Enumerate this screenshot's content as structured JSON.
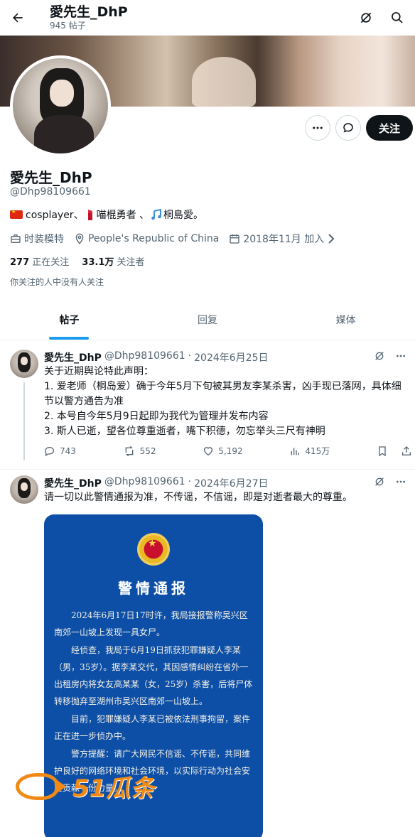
{
  "header": {
    "back_icon": "arrow-left-icon",
    "name": "愛先生_DhP",
    "post_count": "945 帖子",
    "grok_icon": "grok-icon",
    "search_icon": "search-icon"
  },
  "profile": {
    "name": "愛先生_DhP",
    "handle": "@Dhp98109661",
    "bio_part1": "cosplayer、",
    "bio_part2": "喵棍勇者 、",
    "bio_part3": "桐島愛。",
    "profession": "时装模特",
    "location": "People's Republic of China",
    "joined": "2018年11月 加入",
    "following_count": "277",
    "following_label": "正在关注",
    "followers_count": "33.1万",
    "followers_label": "关注者",
    "followers_note": "你关注的人中没有人关注",
    "follow_button": "关注"
  },
  "tabs": [
    {
      "label": "帖子",
      "active": true
    },
    {
      "label": "回复",
      "active": false
    },
    {
      "label": "媒体",
      "active": false
    }
  ],
  "posts": [
    {
      "author": "愛先生_DhP",
      "handle": "@Dhp98109661",
      "date": "2024年6月25日",
      "lines": [
        "关于近期舆论特此声明：",
        "1. 爱老师（桐岛爱）确于今年5月下旬被其男友李某杀害，凶手现已落网，具体细节以警方通告为准",
        "2. 本号自今年5月9日起即为我代为管理并发布内容",
        "3. 斯人已逝，望各位尊重逝者，嘴下积德，勿忘举头三尺有神明"
      ],
      "replies": "743",
      "reposts": "552",
      "likes": "5,192",
      "views": "415万"
    },
    {
      "author": "愛先生_DhP",
      "handle": "@Dhp98109661",
      "date": "2024年6月27日",
      "text": "请一切以此警情通报为准，不传谣，不信谣，即是对逝者最大的尊重。"
    }
  ],
  "notice": {
    "title": "警情通报",
    "p1": "2024年6月17日17时许，我局接报警称吴兴区南郊一山坡上发现一具女尸。",
    "p2": "经侦查，我局于6月19日抓获犯罪嫌疑人李某（男，35岁）。据李某交代，其因感情纠纷在省外一出租房内将女友高某某（女，25岁）杀害，后将尸体转移抛弃至湖州市吴兴区南郊一山坡上。",
    "p3": "目前，犯罪嫌疑人李某已被依法刑事拘留，案件正在进一步侦办中。",
    "p4": "警方提醒：请广大网民不信谣、不传谣，共同维护良好的网络环境和社会环境，以实际行动为社会安定贡献一份力量。"
  },
  "watermark": "51瓜条"
}
